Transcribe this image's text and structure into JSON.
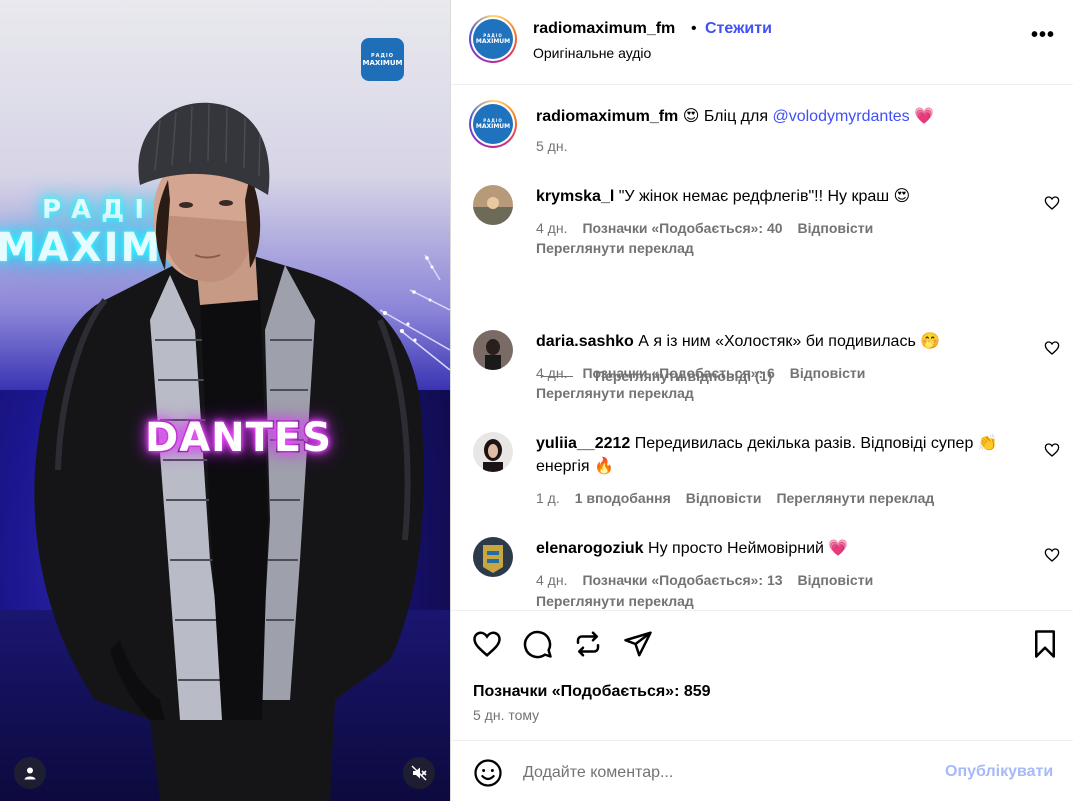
{
  "media": {
    "brand_badge_line1": "РАДІО",
    "brand_badge_line2": "MAXIMUM",
    "neon_small": "РАДІО",
    "neon_big": "MAXIMUM",
    "sticker_text": "DANTES"
  },
  "header": {
    "username": "radiomaximum_fm",
    "separator": "•",
    "follow_label": "Стежити",
    "audio_label": "Оригінальне аудіо",
    "more_label": "•••"
  },
  "caption": {
    "username": "radiomaximum_fm",
    "emoji": "😍",
    "text": "Бліц для",
    "mention": "@volodymyrdantes",
    "heart": "💗",
    "time": "5 дн."
  },
  "comments": [
    {
      "username": "krymska_l",
      "text": "\"У жінок немає редфлегів\"!! Ну краш 😍",
      "time": "4 дн.",
      "likes": "Позначки «Подобається»: 40",
      "reply": "Відповісти",
      "translate": "Переглянути переклад"
    },
    {
      "username": "daria.sashko",
      "text": "А я із ним «Холостяк» би подивилась 🤭",
      "time": "4 дн.",
      "likes": "Позначки «Подобається»: 6",
      "reply": "Відповісти",
      "translate": "Переглянути переклад"
    },
    {
      "username": "yuliia__2212",
      "text": "Передивилась декілька разів. Відповіді супер 👏 енергія 🔥",
      "time": "1 д.",
      "likes": "1 вподобання",
      "reply": "Відповісти",
      "translate": "Переглянути переклад"
    },
    {
      "username": "elenarogoziuk",
      "text": "Ну просто Неймовірний 💗",
      "time": "4 дн.",
      "likes": "Позначки «Подобається»: 13",
      "reply": "Відповісти",
      "translate": "Переглянути переклад"
    }
  ],
  "view_replies": "Переглянути відповіді (1)",
  "actions": {
    "likes": "Позначки «Подобається»: 859",
    "time": "5 дн. тому"
  },
  "composer": {
    "placeholder": "Додайте коментар...",
    "publish_label": "Опублікувати"
  },
  "colors": {
    "link": "#4150f7",
    "secondary_text": "#737373",
    "publish_disabled": "#a6b9f8",
    "brand_blue": "#1f72bd"
  }
}
